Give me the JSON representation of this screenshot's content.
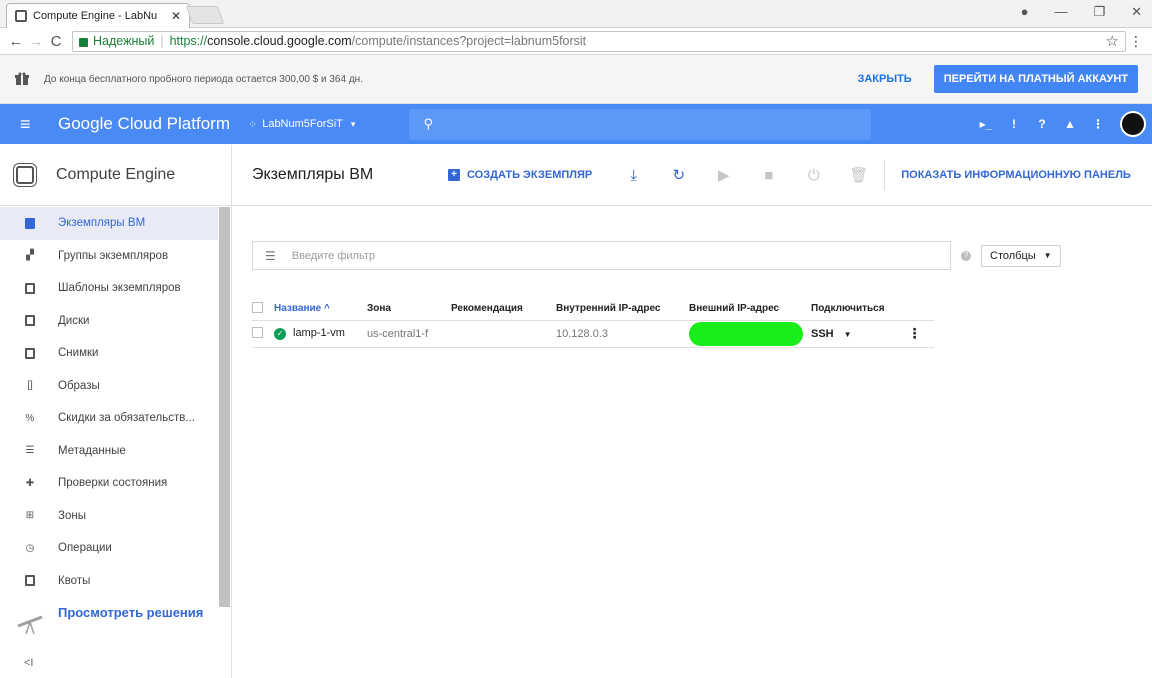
{
  "browser": {
    "tab_title": "Compute Engine - LabNu",
    "tab_close": "✕",
    "back": "←",
    "forward": "→",
    "reload": "C",
    "secure_label": "Надежный",
    "url_scheme": "https://",
    "url_host": "console.cloud.google.com",
    "url_path": "/compute/instances?project=labnum5forsit",
    "star": "☆",
    "menu": "⋮",
    "win_controls": [
      "●",
      "—",
      "❐",
      "✕"
    ]
  },
  "trial": {
    "text": "До конца бесплатного пробного периода остается 300,00 $ и 364 дн.",
    "close_label": "ЗАКРЫТЬ",
    "upgrade_label": "ПЕРЕЙТИ НА ПЛАТНЫЙ АККАУНТ"
  },
  "header": {
    "menu_icon": "≡",
    "brand": "Google Cloud Platform",
    "project": "LabNum5ForSiT",
    "project_caret": "▾",
    "search_icon": "⚲",
    "icons": [
      "▸_",
      "!",
      "?",
      "▲",
      "⋮"
    ]
  },
  "sidebar": {
    "title": "Compute Engine",
    "items": [
      {
        "label": "Экземпляры ВМ",
        "icon": "vm-instances-icon",
        "active": true
      },
      {
        "label": "Группы экземпляров",
        "icon": "instance-groups-icon",
        "active": false
      },
      {
        "label": "Шаблоны экземпляров",
        "icon": "instance-templates-icon",
        "active": false
      },
      {
        "label": "Диски",
        "icon": "disk-icon",
        "active": false
      },
      {
        "label": "Снимки",
        "icon": "snapshot-icon",
        "active": false
      },
      {
        "label": "Образы",
        "icon": "image-icon",
        "active": false
      },
      {
        "label": "Скидки за обязательств...",
        "icon": "discount-icon",
        "active": false
      },
      {
        "label": "Метаданные",
        "icon": "metadata-icon",
        "active": false
      },
      {
        "label": "Проверки состояния",
        "icon": "health-check-icon",
        "active": false
      },
      {
        "label": "Зоны",
        "icon": "zones-icon",
        "active": false
      },
      {
        "label": "Операции",
        "icon": "operations-icon",
        "active": false
      },
      {
        "label": "Квоты",
        "icon": "quotas-icon",
        "active": false
      }
    ],
    "solutions_label": "Просмотреть решения",
    "collapse_label": "<I"
  },
  "main": {
    "title": "Экземпляры ВМ",
    "create_label": "СОЗДАТЬ ЭКЗЕМПЛЯР",
    "create_icon": "+",
    "toolbar_icons": [
      "⤓",
      "↻",
      "▶",
      "■",
      "⏻",
      "🗑"
    ],
    "info_panel_label": "ПОКАЗАТЬ ИНФОРМАЦИОННУЮ ПАНЕЛЬ",
    "filter_placeholder": "Введите фильтр",
    "filter_icon": "☰",
    "help_icon": "?",
    "columns_label": "Столбцы",
    "table": {
      "headers": [
        "Название ^",
        "Зона",
        "Рекомендация",
        "Внутренний IP-адрес",
        "Внешний IP-адрес",
        "Подключиться"
      ],
      "rows": [
        {
          "name": "lamp-1-vm",
          "zone": "us-central1-f",
          "recommendation": "",
          "internal_ip": "10.128.0.3",
          "external_ip": "",
          "connect": "SSH",
          "status": "running"
        }
      ]
    }
  }
}
